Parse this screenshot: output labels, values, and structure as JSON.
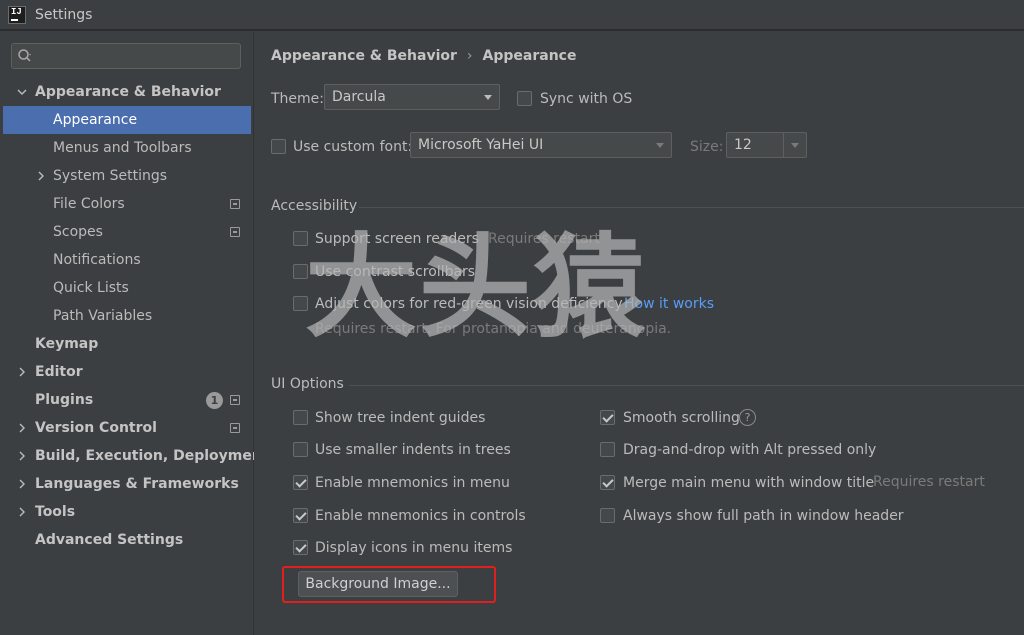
{
  "window": {
    "title": "Settings",
    "logo_text": "IJ"
  },
  "sidebar": {
    "search": {
      "value": "",
      "placeholder": ""
    },
    "items": [
      {
        "label": "Appearance & Behavior",
        "expanded": true,
        "bold": true
      },
      {
        "label": "Appearance",
        "selected": true
      },
      {
        "label": "Menus and Toolbars"
      },
      {
        "label": "System Settings",
        "collapsed": true
      },
      {
        "label": "File Colors"
      },
      {
        "label": "Scopes"
      },
      {
        "label": "Notifications"
      },
      {
        "label": "Quick Lists"
      },
      {
        "label": "Path Variables"
      },
      {
        "label": "Keymap",
        "bold": true
      },
      {
        "label": "Editor",
        "bold": true,
        "collapsed": true
      },
      {
        "label": "Plugins",
        "bold": true,
        "badge": "1"
      },
      {
        "label": "Version Control",
        "bold": true,
        "collapsed": true
      },
      {
        "label": "Build, Execution, Deployment",
        "bold": true,
        "collapsed": true
      },
      {
        "label": "Languages & Frameworks",
        "bold": true,
        "collapsed": true
      },
      {
        "label": "Tools",
        "bold": true,
        "collapsed": true
      },
      {
        "label": "Advanced Settings",
        "bold": true
      }
    ]
  },
  "breadcrumb": {
    "parent": "Appearance & Behavior",
    "separator": "›",
    "current": "Appearance"
  },
  "theme": {
    "label": "Theme:",
    "value": "Darcula",
    "sync_label": "Sync with OS",
    "sync_checked": false
  },
  "font": {
    "custom_label": "Use custom font:",
    "custom_checked": false,
    "value": "Microsoft YaHei UI",
    "size_label": "Size:",
    "size_value": "12"
  },
  "accessibility": {
    "title": "Accessibility",
    "screen_readers_label": "Support screen readers",
    "screen_readers_hint": "Requires restart",
    "contrast_label": "Use contrast scrollbars",
    "colors_label": "Adjust colors for red-green vision deficiency",
    "colors_link": "How it works",
    "colors_hint": "Requires restart. For protanopia and deuteranopia."
  },
  "ui_options": {
    "title": "UI Options",
    "left": [
      {
        "label": "Show tree indent guides",
        "checked": false
      },
      {
        "label": "Use smaller indents in trees",
        "checked": false
      },
      {
        "label": "Enable mnemonics in menu",
        "checked": true
      },
      {
        "label": "Enable mnemonics in controls",
        "checked": true
      },
      {
        "label": "Display icons in menu items",
        "checked": true
      }
    ],
    "right": [
      {
        "label": "Smooth scrolling",
        "checked": true
      },
      {
        "label": "Drag-and-drop with Alt pressed only",
        "checked": false
      },
      {
        "label": "Merge main menu with window title",
        "checked": true,
        "hint": "Requires restart"
      },
      {
        "label": "Always show full path in window header",
        "checked": false
      }
    ],
    "help_glyph": "?",
    "background_button": "Background Image..."
  },
  "watermark": "大头猿",
  "colors": {
    "selection": "#4b6eaf",
    "highlight_box": "#e0201c",
    "link": "#589df6"
  }
}
